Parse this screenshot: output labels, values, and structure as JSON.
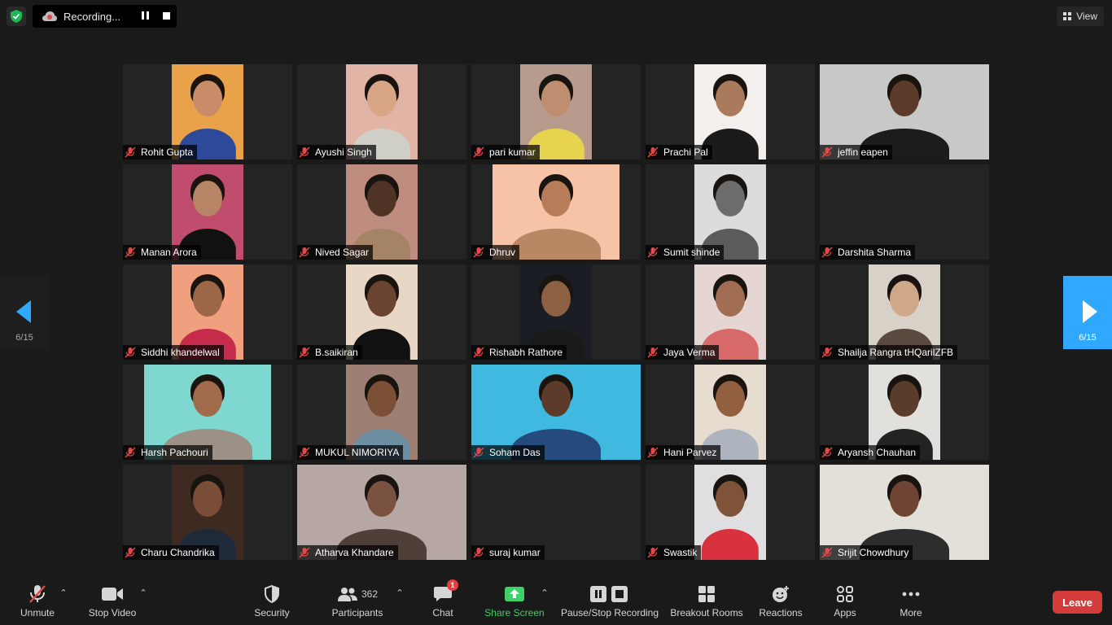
{
  "recording": {
    "label": "Recording..."
  },
  "view": {
    "label": "View"
  },
  "pagination": {
    "left_label": "6/15",
    "right_label": "6/15"
  },
  "participants": [
    {
      "name": "Rohit Gupta",
      "bg": "#e9a24a",
      "skin": "#c98b68",
      "shirt": "#2d4a9a",
      "vx": 60,
      "vw": 88
    },
    {
      "name": "Ayushi Singh",
      "bg": "#e1b4a6",
      "skin": "#d8a585",
      "shirt": "#cfcfc8",
      "vx": 60,
      "vw": 88
    },
    {
      "name": "pari kumar",
      "bg": "#b79c8d",
      "skin": "#bf8d70",
      "shirt": "#e7d34e",
      "vx": 60,
      "vw": 88
    },
    {
      "name": "Prachi Pal",
      "bg": "#f2efed",
      "skin": "#a97a5b",
      "shirt": "#1b1b1b",
      "vx": 60,
      "vw": 88
    },
    {
      "name": "jeffin eapen",
      "bg": "#c8c8c8",
      "skin": "#5b3b2a",
      "shirt": "#1c1c1c",
      "vx": 0,
      "vw": 208
    },
    {
      "name": "Manan Arora",
      "bg": "#c04d6d",
      "skin": "#b88466",
      "shirt": "#111111",
      "vx": 60,
      "vw": 88
    },
    {
      "name": "Nived Sagar",
      "bg": "#bf8c80",
      "skin": "#4f3324",
      "shirt": "#a58367",
      "vx": 60,
      "vw": 88
    },
    {
      "name": "Dhruv",
      "bg": "#f7c3a7",
      "skin": "#b77c58",
      "shirt": "#b98764",
      "vx": 26,
      "vw": 156
    },
    {
      "name": "Sumit shinde",
      "bg": "#dcdcdc",
      "skin": "#6c6c6c",
      "shirt": "#5b5b5b",
      "vx": 60,
      "vw": 88
    },
    {
      "name": "Darshita Sharma",
      "bg": "",
      "skin": "",
      "shirt": "",
      "vx": 0,
      "vw": 0
    },
    {
      "name": "Siddhi khandelwal",
      "bg": "#f0a07f",
      "skin": "#9d6747",
      "shirt": "#c62b4b",
      "vx": 60,
      "vw": 88
    },
    {
      "name": "B.saikiran",
      "bg": "#e7d7c4",
      "skin": "#6b4431",
      "shirt": "#111111",
      "vx": 60,
      "vw": 88
    },
    {
      "name": "Rishabh Rathore",
      "bg": "#1b1d24",
      "skin": "#8d5f43",
      "shirt": "#1a1a1a",
      "vx": 60,
      "vw": 88
    },
    {
      "name": "Jaya Verma",
      "bg": "#e6d6d3",
      "skin": "#a16d53",
      "shirt": "#d86a6a",
      "vx": 60,
      "vw": 88
    },
    {
      "name": "Shailja Rangra tHQarilZFB",
      "bg": "#d7d1c8",
      "skin": "#cfa889",
      "shirt": "#5a4a40",
      "vx": 60,
      "vw": 88
    },
    {
      "name": "Harsh Pachouri",
      "bg": "#7fd8cf",
      "skin": "#a06a4b",
      "shirt": "#9b9186",
      "vx": 26,
      "vw": 156
    },
    {
      "name": "MUKUL NIMORIYA",
      "bg": "#9d8073",
      "skin": "#7c5037",
      "shirt": "#6e8ea1",
      "vx": 60,
      "vw": 88
    },
    {
      "name": "Soham Das",
      "bg": "#3fb9e0",
      "skin": "#5d3b2a",
      "shirt": "#254b7c",
      "vx": 0,
      "vw": 208
    },
    {
      "name": "Hani Parvez",
      "bg": "#e6ddd0",
      "skin": "#93603f",
      "shirt": "#aeb4bd",
      "vx": 60,
      "vw": 88
    },
    {
      "name": "Aryansh Chauhan",
      "bg": "#e2e0dc",
      "skin": "#5a3c2b",
      "shirt": "#232323",
      "vx": 60,
      "vw": 88
    },
    {
      "name": "Charu Chandrika",
      "bg": "#3e2a20",
      "skin": "#7a4d36",
      "shirt": "#1e2a3a",
      "vx": 60,
      "vw": 88
    },
    {
      "name": "Atharva Khandare",
      "bg": "#b7a7a4",
      "skin": "#7a5340",
      "shirt": "#4f3f38",
      "vx": 0,
      "vw": 208
    },
    {
      "name": "suraj kumar",
      "bg": "",
      "skin": "",
      "shirt": "",
      "vx": 0,
      "vw": 0
    },
    {
      "name": "Swastik",
      "bg": "#dfdfe1",
      "skin": "#7f5338",
      "shirt": "#d9313d",
      "vx": 60,
      "vw": 88
    },
    {
      "name": "Srijit Chowdhury",
      "bg": "#e3e0da",
      "skin": "#6d4532",
      "shirt": "#2d2d2d",
      "vx": 0,
      "vw": 208
    }
  ],
  "toolbar": {
    "unmute": "Unmute",
    "stop_video": "Stop Video",
    "security": "Security",
    "participants": "Participants",
    "participants_count": "362",
    "chat": "Chat",
    "chat_badge": "1",
    "share_screen": "Share Screen",
    "pause_stop_recording": "Pause/Stop Recording",
    "breakout_rooms": "Breakout Rooms",
    "reactions": "Reactions",
    "apps": "Apps",
    "more": "More",
    "leave": "Leave"
  },
  "colors": {
    "accent": "#2ea9ff",
    "share_green": "#3dd168",
    "leave_red": "#d43c3c",
    "mic_off_red": "#e24848"
  }
}
